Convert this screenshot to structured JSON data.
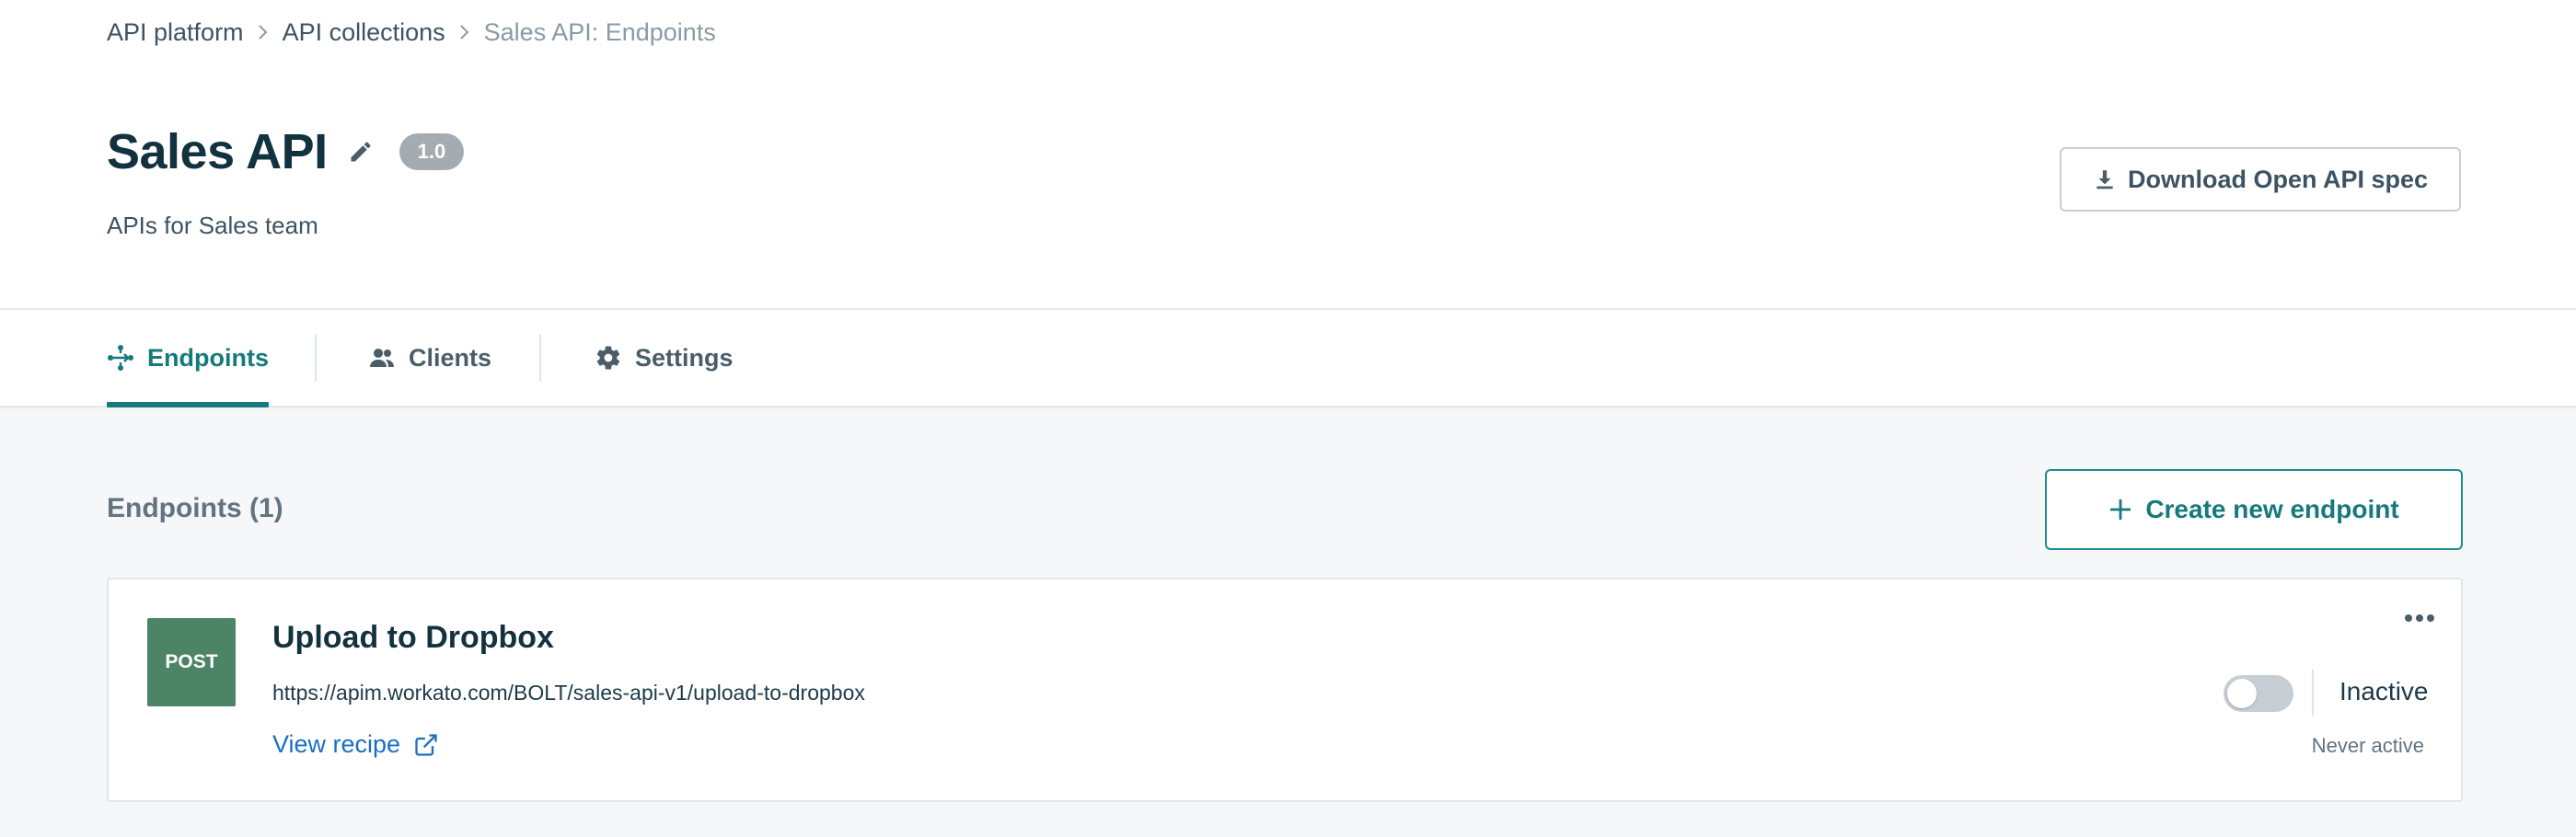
{
  "breadcrumb": {
    "items": [
      "API platform",
      "API collections"
    ],
    "current": "Sales API: Endpoints"
  },
  "header": {
    "title": "Sales API",
    "version": "1.0",
    "description": "APIs for Sales team",
    "download_label": "Download Open API spec"
  },
  "tabs": [
    {
      "label": "Endpoints",
      "icon": "endpoints-icon",
      "active": true
    },
    {
      "label": "Clients",
      "icon": "users-icon",
      "active": false
    },
    {
      "label": "Settings",
      "icon": "gear-icon",
      "active": false
    }
  ],
  "section": {
    "title": "Endpoints (1)",
    "create_label": "Create new endpoint"
  },
  "endpoints": [
    {
      "method": "POST",
      "title": "Upload to Dropbox",
      "url": "https://apim.workato.com/BOLT/sales-api-v1/upload-to-dropbox",
      "view_recipe_label": "View recipe",
      "status": "Inactive",
      "last_active": "Never active",
      "enabled": false
    }
  ],
  "colors": {
    "accent": "#167a7d",
    "link": "#1a6fc4",
    "post_method": "#4d8466",
    "version_badge": "#a4acb2"
  }
}
